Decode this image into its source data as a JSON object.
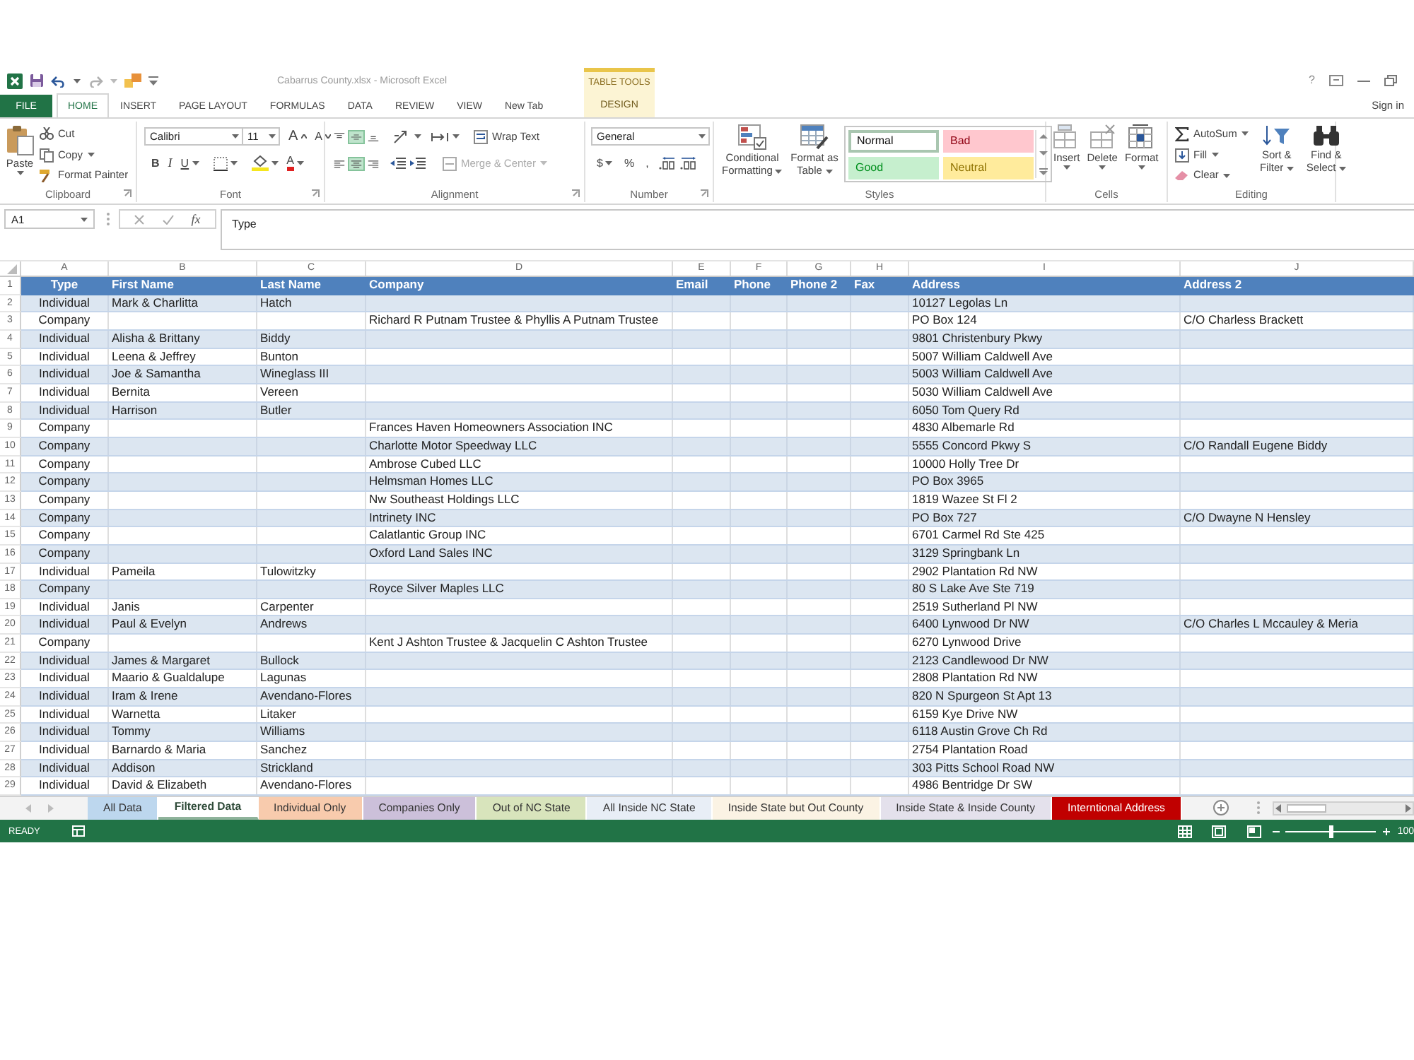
{
  "title_bar": {
    "title": "Cabarrus County.xlsx - Microsoft Excel",
    "help": "?"
  },
  "ribbon_tabs": [
    {
      "label": "FILE",
      "kind": "file",
      "selected": false
    },
    {
      "label": "HOME",
      "kind": "tab",
      "selected": true
    },
    {
      "label": "INSERT",
      "kind": "tab",
      "selected": false
    },
    {
      "label": "PAGE LAYOUT",
      "kind": "tab",
      "selected": false
    },
    {
      "label": "FORMULAS",
      "kind": "tab",
      "selected": false
    },
    {
      "label": "DATA",
      "kind": "tab",
      "selected": false
    },
    {
      "label": "REVIEW",
      "kind": "tab",
      "selected": false
    },
    {
      "label": "VIEW",
      "kind": "tab",
      "selected": false
    },
    {
      "label": "New Tab",
      "kind": "tab",
      "selected": false
    },
    {
      "label": "DESIGN",
      "kind": "contextual",
      "group": "TABLE TOOLS",
      "selected": false
    }
  ],
  "sign_in": "Sign in",
  "ribbon": {
    "clipboard": {
      "label": "Clipboard",
      "paste": "Paste",
      "cut": "Cut",
      "copy": "Copy",
      "format_painter": "Format Painter"
    },
    "font": {
      "label": "Font",
      "name": "Calibri",
      "size": "11",
      "grow": "A",
      "shrink": "A",
      "bold": "B",
      "italic": "I",
      "underline": "U",
      "font_color_button": "A"
    },
    "alignment": {
      "label": "Alignment",
      "vertical": [
        {
          "kind": "top",
          "selected": false
        },
        {
          "kind": "middle",
          "selected": true
        },
        {
          "kind": "bottom",
          "selected": false
        }
      ],
      "horizontal": [
        {
          "kind": "left",
          "selected": false
        },
        {
          "kind": "center",
          "selected": true
        },
        {
          "kind": "right",
          "selected": false
        }
      ],
      "wrap_text": "Wrap Text",
      "merge": {
        "label": "Merge & Center",
        "disabled": true
      }
    },
    "number": {
      "label": "Number",
      "format": "General",
      "currency": "$",
      "percent": "%",
      "comma": ","
    },
    "styles": {
      "label": "Styles",
      "conditional_formatting": "Conditional Formatting",
      "format_as_table": "Format as Table",
      "gallery": [
        {
          "label": "Normal",
          "color": "#ffffff",
          "selected": true
        },
        {
          "label": "Bad",
          "color": "#ffc7ce",
          "selected": false
        },
        {
          "label": "Good",
          "color": "#c6efce",
          "selected": false
        },
        {
          "label": "Neutral",
          "color": "#ffeb9c",
          "selected": false
        }
      ]
    },
    "cells": {
      "label": "Cells",
      "buttons": [
        {
          "label": "Insert",
          "kind": "insert"
        },
        {
          "label": "Delete",
          "kind": "delete"
        },
        {
          "label": "Format",
          "kind": "format"
        }
      ]
    },
    "editing": {
      "label": "Editing",
      "autosum": "AutoSum",
      "fill": "Fill",
      "clear": "Clear",
      "sort_filter": "Sort & Filter",
      "find_select": "Find & Select"
    }
  },
  "formula_bar": {
    "name_box": "A1",
    "function_button": "fx",
    "formula": "Type"
  },
  "sheet": {
    "columns": [
      "A",
      "B",
      "C",
      "D",
      "E",
      "F",
      "G",
      "H",
      "I",
      "J"
    ],
    "banded_rows": true,
    "header": {
      "number": "1",
      "cells": [
        "Type",
        "First Name",
        "Last Name",
        "Company",
        "Email",
        "Phone",
        "Phone 2",
        "Fax",
        "Address",
        "Address 2"
      ]
    },
    "rows": [
      {
        "number": "2",
        "type": "Individual",
        "first_name": "Mark & Charlitta",
        "last_name": "Hatch",
        "address": "10127 Legolas Ln"
      },
      {
        "number": "3",
        "type": "Company",
        "company": "Richard R Putnam Trustee & Phyllis A Putnam Trustee",
        "address": "PO Box 124",
        "address_2": "C/O Charless Brackett"
      },
      {
        "number": "4",
        "type": "Individual",
        "first_name": "Alisha & Brittany",
        "last_name": "Biddy",
        "address": "9801 Christenbury Pkwy"
      },
      {
        "number": "5",
        "type": "Individual",
        "first_name": "Leena & Jeffrey",
        "last_name": "Bunton",
        "address": "5007 William Caldwell Ave"
      },
      {
        "number": "6",
        "type": "Individual",
        "first_name": "Joe & Samantha",
        "last_name": "Wineglass III",
        "address": "5003 William Caldwell Ave"
      },
      {
        "number": "7",
        "type": "Individual",
        "first_name": "Bernita",
        "last_name": "Vereen",
        "address": "5030 William Caldwell Ave"
      },
      {
        "number": "8",
        "type": "Individual",
        "first_name": "Harrison",
        "last_name": "Butler",
        "address": "6050 Tom Query Rd"
      },
      {
        "number": "9",
        "type": "Company",
        "company": "Frances Haven Homeowners Association INC",
        "address": "4830 Albemarle Rd"
      },
      {
        "number": "10",
        "type": "Company",
        "company": "Charlotte Motor Speedway LLC",
        "address": "5555 Concord Pkwy S",
        "address_2": "C/O Randall Eugene Biddy"
      },
      {
        "number": "11",
        "type": "Company",
        "company": "Ambrose Cubed LLC",
        "address": "10000 Holly Tree Dr"
      },
      {
        "number": "12",
        "type": "Company",
        "company": "Helmsman Homes LLC",
        "address": "PO Box 3965"
      },
      {
        "number": "13",
        "type": "Company",
        "company": "Nw Southeast Holdings LLC",
        "address": "1819 Wazee St Fl 2"
      },
      {
        "number": "14",
        "type": "Company",
        "company": "Intrinety INC",
        "address": "PO Box 727",
        "address_2": "C/O Dwayne N Hensley"
      },
      {
        "number": "15",
        "type": "Company",
        "company": "Calatlantic Group INC",
        "address": "6701 Carmel Rd Ste 425"
      },
      {
        "number": "16",
        "type": "Company",
        "company": "Oxford Land Sales INC",
        "address": "3129 Springbank Ln"
      },
      {
        "number": "17",
        "type": "Individual",
        "first_name": "Pameila",
        "last_name": "Tulowitzky",
        "address": "2902 Plantation Rd NW"
      },
      {
        "number": "18",
        "type": "Company",
        "company": "Royce Silver Maples LLC",
        "address": "80 S Lake Ave Ste 719"
      },
      {
        "number": "19",
        "type": "Individual",
        "first_name": "Janis",
        "last_name": "Carpenter",
        "address": "2519 Sutherland Pl NW"
      },
      {
        "number": "20",
        "type": "Individual",
        "first_name": "Paul & Evelyn",
        "last_name": "Andrews",
        "address": "6400 Lynwood Dr NW",
        "address_2": "C/O Charles L Mccauley & Meria"
      },
      {
        "number": "21",
        "type": "Company",
        "company": "Kent J Ashton Trustee & Jacquelin C Ashton Trustee",
        "address": "6270 Lynwood Drive"
      },
      {
        "number": "22",
        "type": "Individual",
        "first_name": "James & Margaret",
        "last_name": "Bullock",
        "address": "2123 Candlewood Dr NW"
      },
      {
        "number": "23",
        "type": "Individual",
        "first_name": "Maario & Gualdalupe",
        "last_name": "Lagunas",
        "address": "2808 Plantation Rd NW"
      },
      {
        "number": "24",
        "type": "Individual",
        "first_name": "Iram & Irene",
        "last_name": "Avendano-Flores",
        "address": "820 N Spurgeon St Apt 13"
      },
      {
        "number": "25",
        "type": "Individual",
        "first_name": "Warnetta",
        "last_name": "Litaker",
        "address": "6159 Kye Drive NW"
      },
      {
        "number": "26",
        "type": "Individual",
        "first_name": "Tommy",
        "last_name": "Williams",
        "address": "6118 Austin Grove Ch Rd"
      },
      {
        "number": "27",
        "type": "Individual",
        "first_name": "Barnardo & Maria",
        "last_name": "Sanchez",
        "address": "2754 Plantation Road"
      },
      {
        "number": "28",
        "type": "Individual",
        "first_name": "Addison",
        "last_name": "Strickland",
        "address": "303 Pitts School Road NW"
      },
      {
        "number": "29",
        "type": "Individual",
        "first_name": "David & Elizabeth",
        "last_name": "Avendano-Flores",
        "address": "4986 Bentridge Dr SW"
      }
    ]
  },
  "sheet_tabs": [
    {
      "label": "All Data",
      "color": "#bdd7ee",
      "selected": false
    },
    {
      "label": "Filtered Data",
      "color": "#8fb39b",
      "selected": true
    },
    {
      "label": "Individual Only",
      "color": "#f8cbad",
      "selected": false
    },
    {
      "label": "Companies Only",
      "color": "#ccc0da",
      "selected": false
    },
    {
      "label": "Out of NC State",
      "color": "#d8e4bc",
      "selected": false
    },
    {
      "label": "All Inside NC State",
      "color": "#e8eef6",
      "selected": false
    },
    {
      "label": "Inside State but Out County",
      "color": "#fbf3e4",
      "selected": false
    },
    {
      "label": "Inside State & Inside County",
      "color": "#e4e1ec",
      "selected": false
    },
    {
      "label": "Interntional Address",
      "color": "#c00000",
      "selected": false
    }
  ],
  "status_bar": {
    "mode": "READY",
    "zoom": {
      "level": 0.5,
      "reading": "100"
    }
  }
}
